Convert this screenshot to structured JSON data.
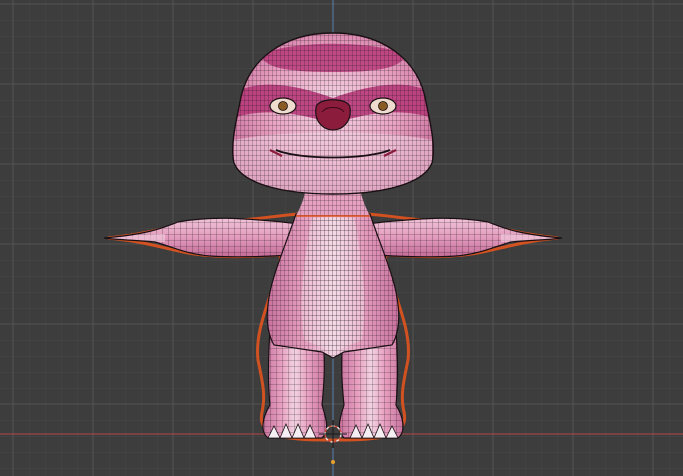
{
  "viewport": {
    "mode": "wireframe-overlay",
    "object": "sloth-character-mesh",
    "selected": true
  },
  "colors": {
    "background": "#3d3d3d",
    "grid_minor": "#474747",
    "grid_major": "#545454",
    "axis_x": "#b5454a",
    "axis_z": "#5b7fb0",
    "mesh_base": "#e9a2c3",
    "mesh_dark": "#b73a7a",
    "mesh_light": "#f2cfe0",
    "wire": "#1c1418",
    "selection_outline": "#e2531e"
  },
  "icons": {
    "origin": "3d-cursor-icon"
  }
}
